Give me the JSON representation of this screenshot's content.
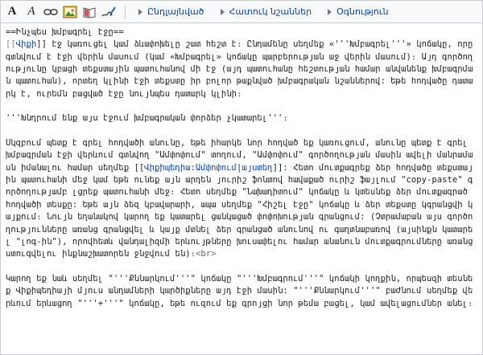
{
  "toolbar": {
    "icons": [
      "bold-icon",
      "italic-icon",
      "link-icon",
      "image-icon",
      "book-icon",
      "signature-icon"
    ],
    "bold_glyph": "A",
    "italic_glyph": "A",
    "tabs": [
      {
        "label": "Ընդլայնված"
      },
      {
        "label": "Հատուկ նշաններ"
      },
      {
        "label": "Օգնություն"
      }
    ]
  },
  "content": {
    "l1": "==Ինչպես խմբագրել էջը==",
    "p1a": "[[",
    "p1b": "Վիքի",
    "p1c": "]] էջ կառուցել կամ ձևափոխելը շատ հեշտ է։ Ընդամենը սեղմեք «'''Խմբագրել'''» կոճակը, որը գտնվում է էջի վերին մասում (կամ «Խմբագրել» կոճակը պարբերության աջ վերին մասում)։ Այդ գործողությունը կբացի տեքստային պատուհանով մի էջ (այդ պատուհանը հեշտության համար անվանենք խմբագրման պատուհան), որտեղ կլինի էջի տեքստը իր բոլոր թաքնված խմբագրական նշաններով: Եթե հոդվածը դատարկ է, ուրեմն բացված էջը նույնպես դատարկ կլինի։",
    "p2": "'''Խնդրում ենք այս էջում խմբագրական փորձեր չկատարել'''։",
    "p3a": "Սկզբում պետք է գրել հոդվածի անունը, եթե իհարկե նոր հոդված եք կառուցում, անունը պետք է գրել խմբագրման էջի վերևում գտնվող \"Ամփոփում\" տողում, \"Ամփոփում\" գործողության մասին ավելի մանրամասն իմանալու համար սեղմեք [[",
    "p3b": "Վիքիպեդիա:Ամփոփում|այստեղ",
    "p3c": "]]: Հետո մուտքագրեք ձեր հոդվածը տեքստային պատուհանի մեջ կամ եթե ունեք այն արդեն յուրիշ ֆոնտով հավաքած ուրիշ ֆայլում \"copy-paste\" գործողությամբ լցրեք պատուհանի մեջ։ Հետո սեղմեք \"Նախադիտում\" կոճակը և կտեսնեք ձեր մուտքագրած հոդվածի տեսքը: Եթե այն ձեզ կբավարարի, ապա սեղմեք \"Հիշել էջը\" կոճակը և ձեր տեքստը կգրանցվի կայքում։ Նույն եղանակով կարող եք կատարել ցանկացած փոփոխության գրանցում: (Չտրամաբան այս գործողությունները առանց գրանցվել և կայք մտնել ձեր գրանցած անունով ու գաղտնաբառով (այսինքն կատարել \"լոգ-ին\"), որովհետև վանդալիզմի երևույթները խուսափելու համար անանուն մուտքագրումները առանց ստուգվելու ինքնաշխատորեն ջնջվում են)։",
    "br": "<br>",
    "p4": "Կարող եք նաև սեղմել \"'''Քննարկում'''\" կոճակը \"'''Խմբագրում'''\" կոճակի կողքին, որպեսզի տեսնեք Վիքիպեդիայի մյուս անդամների կարծիքները այդ էջի մասին: \"'''Քննարկում'''\" բաժնում սեղմեք վերևում երևացող \"'''+'''\" կոճակը, եթե ուզում եք գրոյցի նոր թեմա բացել, կամ ավելացումներ անել։"
  }
}
